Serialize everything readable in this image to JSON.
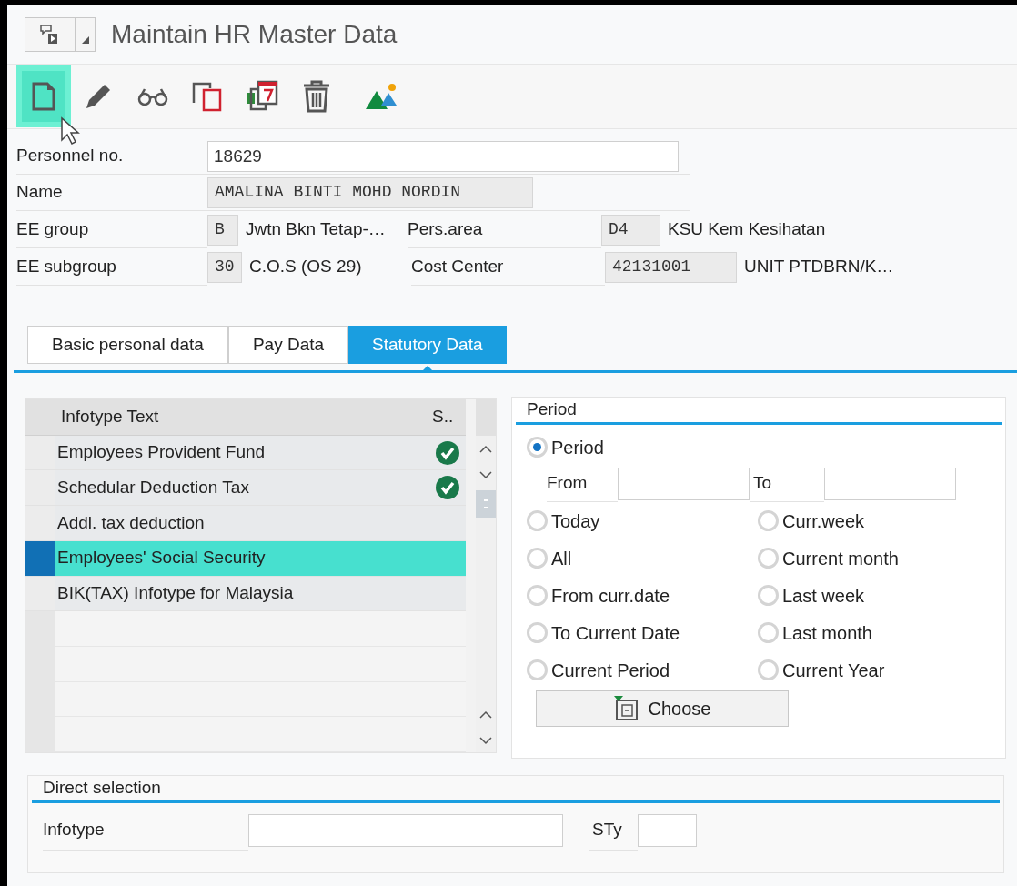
{
  "window": {
    "title": "Maintain HR Master Data"
  },
  "toolbar": [
    {
      "kind": "new",
      "highlighted": true
    },
    {
      "kind": "edit",
      "highlighted": false
    },
    {
      "kind": "display",
      "highlighted": false
    },
    {
      "kind": "copy",
      "highlighted": false
    },
    {
      "kind": "delimit",
      "highlighted": false
    },
    {
      "kind": "delete",
      "highlighted": false
    },
    {
      "kind": "overview",
      "highlighted": false
    }
  ],
  "header": {
    "personnel_no": {
      "label": "Personnel no.",
      "value": "18629"
    },
    "name": {
      "label": "Name",
      "value": "AMALINA BINTI MOHD NORDIN"
    },
    "org_rows": [
      {
        "label": "EE group",
        "code": "B",
        "text": "Jwtn Bkn Tetap-…",
        "label_2": "Pers.area",
        "code_2": "D4",
        "text_2": "KSU Kem Kesihatan"
      },
      {
        "label": "EE subgroup",
        "code": "30",
        "text": "C.O.S (OS 29)",
        "label_2": "Cost Center",
        "code_2": "42131001",
        "text_2": "UNIT PTDBRN/K…"
      }
    ]
  },
  "tabs": [
    {
      "label": "Basic personal data",
      "selected": false
    },
    {
      "label": "Pay Data",
      "selected": false
    },
    {
      "label": "Statutory Data",
      "selected": true
    }
  ],
  "infotype_table": {
    "columns": [
      "Infotype Text",
      "S.."
    ],
    "rows": [
      {
        "text": "Employees Provident Fund",
        "status_ok": true,
        "selected": false
      },
      {
        "text": "Schedular Deduction Tax",
        "status_ok": true,
        "selected": false
      },
      {
        "text": "Addl. tax deduction",
        "status_ok": false,
        "selected": false
      },
      {
        "text": "Employees' Social Security",
        "status_ok": false,
        "selected": true
      },
      {
        "text": "BIK(TAX) Infotype for Malaysia",
        "status_ok": false,
        "selected": false
      }
    ]
  },
  "period": {
    "title": "Period",
    "main_option": {
      "label": "Period",
      "selected": true
    },
    "from_label": "From",
    "to_label": "To",
    "options": [
      {
        "label": "Today",
        "selected": false
      },
      {
        "label": "Curr.week",
        "selected": false
      },
      {
        "label": "All",
        "selected": false
      },
      {
        "label": "Current month",
        "selected": false
      },
      {
        "label": "From curr.date",
        "selected": false
      },
      {
        "label": "Last week",
        "selected": false
      },
      {
        "label": "To Current Date",
        "selected": false
      },
      {
        "label": "Last month",
        "selected": false
      },
      {
        "label": "Current Period",
        "selected": false
      },
      {
        "label": "Current Year",
        "selected": false
      }
    ],
    "choose_button": "Choose"
  },
  "direct_selection": {
    "title": "Direct selection",
    "infotype_label": "Infotype",
    "subtype_label": "STy"
  }
}
